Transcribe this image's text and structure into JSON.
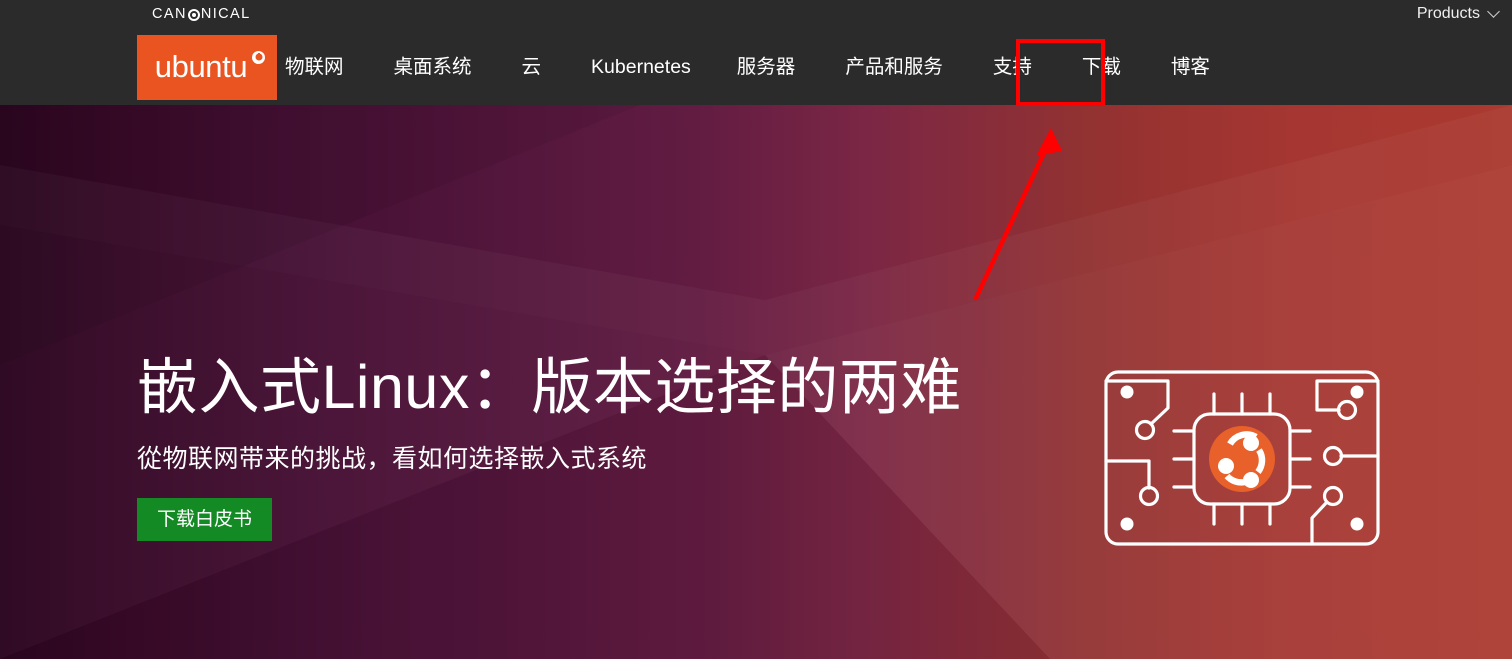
{
  "topbar": {
    "brand": {
      "prefix": "CAN",
      "icon": "canonical-ring-icon",
      "suffix": "NICAL",
      "full": "CANONICAL"
    },
    "products": {
      "label": "Products",
      "icon": "chevron-down-icon"
    }
  },
  "nav": {
    "logo": {
      "word": "ubuntu",
      "mark": "registered-trademark",
      "bg": "#E95420"
    },
    "items": [
      {
        "label": "物联网",
        "highlighted": false
      },
      {
        "label": "桌面系统",
        "highlighted": false
      },
      {
        "label": "云",
        "highlighted": false
      },
      {
        "label": "Kubernetes",
        "highlighted": false
      },
      {
        "label": "服务器",
        "highlighted": false
      },
      {
        "label": "产品和服务",
        "highlighted": false
      },
      {
        "label": "支持",
        "highlighted": false
      },
      {
        "label": "下载",
        "highlighted": true
      },
      {
        "label": "博客",
        "highlighted": false
      }
    ]
  },
  "hero": {
    "title": "嵌入式Linux：版本选择的两难",
    "subtitle": "從物联网带来的挑战，看如何选择嵌入式系统",
    "cta_label": "下载白皮书",
    "cta_color": "#138a23",
    "illustration": "circuit-board-with-ubuntu-chip-icon"
  },
  "annotations": {
    "highlight_box": {
      "target": "下载",
      "color": "#FF0000"
    },
    "arrow": {
      "color": "#FF0000",
      "points_to": "下载"
    }
  },
  "colors": {
    "navbar_bg": "#2b2b2b",
    "ubuntu_orange": "#E95420",
    "hero_gradient_start": "#2c0620",
    "hero_gradient_end": "#aa3a30",
    "annotation_red": "#FF0000",
    "cta_green": "#138a23"
  }
}
